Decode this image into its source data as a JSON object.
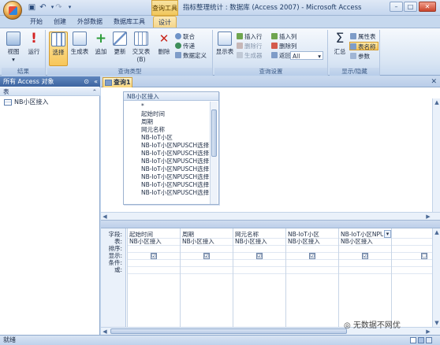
{
  "window": {
    "title": "指标整理统计 : 数据库 (Access 2007) - Microsoft Access",
    "context_tab": "查询工具",
    "controls": {
      "minimize": "–",
      "maximize": "□",
      "close": "✕"
    }
  },
  "quick_access": {
    "save_icon": "save-icon",
    "undo_icon": "undo-icon",
    "redo_icon": "redo-icon",
    "more": "▾"
  },
  "ribbon_tabs": [
    {
      "label": "开始"
    },
    {
      "label": "创建"
    },
    {
      "label": "外部数据"
    },
    {
      "label": "数据库工具"
    },
    {
      "label": "设计",
      "active": true
    }
  ],
  "ribbon": {
    "groups": {
      "results": {
        "label": "结果",
        "view": "视图",
        "view_arrow": "▾",
        "run": "运行"
      },
      "query_type": {
        "label": "查询类型",
        "select": "选择",
        "make_table": "生成表",
        "append": "追加",
        "update": "更新",
        "crosstab": "交叉表",
        "delete": "删除",
        "union": "联合",
        "pass_through": "传递",
        "data_definition": "数据定义"
      },
      "query_setup": {
        "label": "查询设置",
        "show_table": "显示表",
        "insert_rows": "插入行",
        "delete_rows": "删除行",
        "builder": "生成器",
        "insert_columns": "插入列",
        "delete_columns": "删除列",
        "return_label": "返回:",
        "return_value": "All"
      },
      "show_hide": {
        "label": "显示/隐藏",
        "totals": "汇总",
        "property_sheet": "属性表",
        "table_names": "表名称",
        "parameters": "参数"
      }
    }
  },
  "nav_pane": {
    "header": "所有 Access 对象",
    "group": "表",
    "items": [
      {
        "label": "NB小区接入"
      }
    ]
  },
  "document": {
    "tab_label": "查询1",
    "table_box": {
      "title": "NB小区接入",
      "fields": [
        "*",
        "起始时间",
        "周期",
        "网元名称",
        "NB-IoT小区",
        "NB-IoT小区NPUSCH选择1",
        "NB-IoT小区NPUSCH选择1",
        "NB-IoT小区NPUSCH选择1",
        "NB-IoT小区NPUSCH选择1",
        "NB-IoT小区NPUSCH选择1",
        "NB-IoT小区NPUSCH选择1",
        "NB-IoT小区NPUSCH选择1"
      ]
    },
    "grid": {
      "row_labels": [
        "字段:",
        "表:",
        "排序:",
        "显示:",
        "条件:",
        "或:"
      ],
      "columns": [
        {
          "field": "起始时间",
          "table": "NB小区接入",
          "show": "☑"
        },
        {
          "field": "周期",
          "table": "NB小区接入",
          "show": "☑"
        },
        {
          "field": "网元名称",
          "table": "NB小区接入",
          "show": "☑"
        },
        {
          "field": "NB-IoT小区",
          "table": "NB小区接入",
          "show": "☑"
        },
        {
          "field": "NB-IoT小区NPUSCH",
          "table": "NB小区接入",
          "show": "☑"
        },
        {
          "field": "",
          "table": "",
          "show": "☐"
        }
      ]
    }
  },
  "status": {
    "text": "就绪"
  },
  "watermark": "无数据不网优"
}
